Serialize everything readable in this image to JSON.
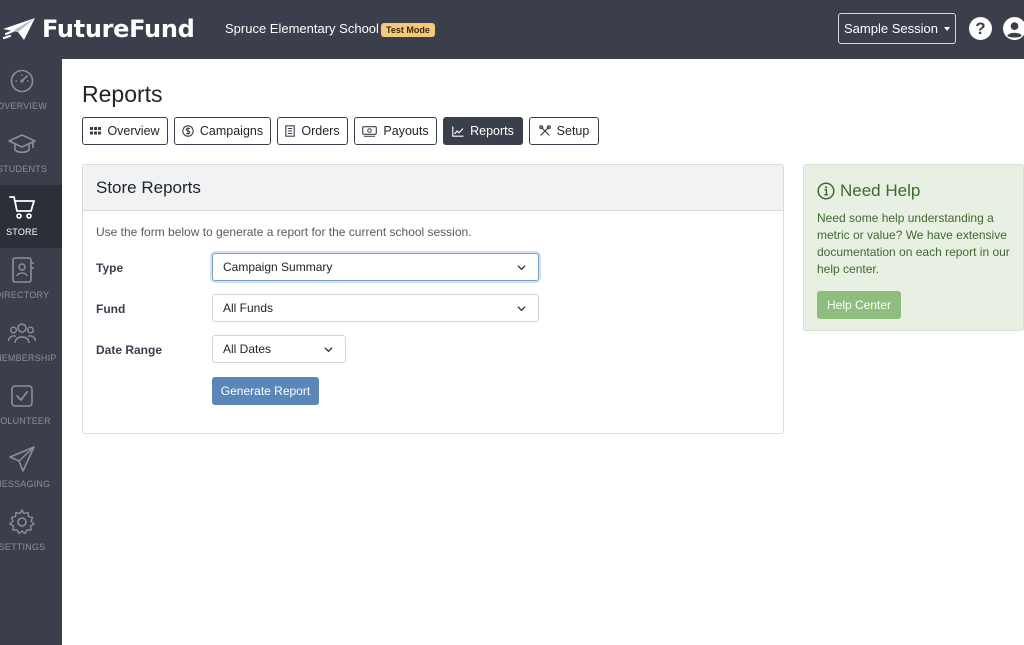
{
  "header": {
    "brand": "FutureFund",
    "school": "Spruce Elementary School",
    "mode_badge": "Test Mode",
    "session_label": "Sample Session",
    "help_glyph": "?"
  },
  "sidebar": {
    "items": [
      {
        "label": "OVERVIEW",
        "icon": "gauge-icon"
      },
      {
        "label": "STUDENTS",
        "icon": "graduation-cap-icon"
      },
      {
        "label": "STORE",
        "icon": "cart-icon",
        "active": true
      },
      {
        "label": "DIRECTORY",
        "icon": "contact-book-icon"
      },
      {
        "label": "MEMBERSHIP",
        "icon": "people-icon"
      },
      {
        "label": "VOLUNTEER",
        "icon": "checkbox-icon"
      },
      {
        "label": "MESSAGING",
        "icon": "paper-plane-icon"
      },
      {
        "label": "SETTINGS",
        "icon": "gear-icon"
      }
    ]
  },
  "page": {
    "title": "Reports",
    "tabs": [
      {
        "label": "Overview",
        "icon": "grid-icon"
      },
      {
        "label": "Campaigns",
        "icon": "dollar-circle-icon"
      },
      {
        "label": "Orders",
        "icon": "receipt-icon"
      },
      {
        "label": "Payouts",
        "icon": "money-icon"
      },
      {
        "label": "Reports",
        "icon": "chart-line-icon",
        "active": true
      },
      {
        "label": "Setup",
        "icon": "tools-icon"
      }
    ]
  },
  "store_reports": {
    "title": "Store Reports",
    "intro": "Use the form below to generate a report for the current school session.",
    "type_label": "Type",
    "type_value": "Campaign Summary",
    "fund_label": "Fund",
    "fund_value": "All Funds",
    "date_label": "Date Range",
    "date_value": "All Dates",
    "submit_label": "Generate Report"
  },
  "help": {
    "title": "Need Help",
    "text": "Need some help understanding a metric or value? We have extensive documentation on each report in our help center.",
    "button_label": "Help Center"
  },
  "colors": {
    "nav_bg": "#3a3f4b",
    "primary_button": "#5b86b8",
    "help_bg": "#e8f0e3",
    "help_button": "#8fbd7e",
    "badge_bg": "#f5c97a"
  }
}
